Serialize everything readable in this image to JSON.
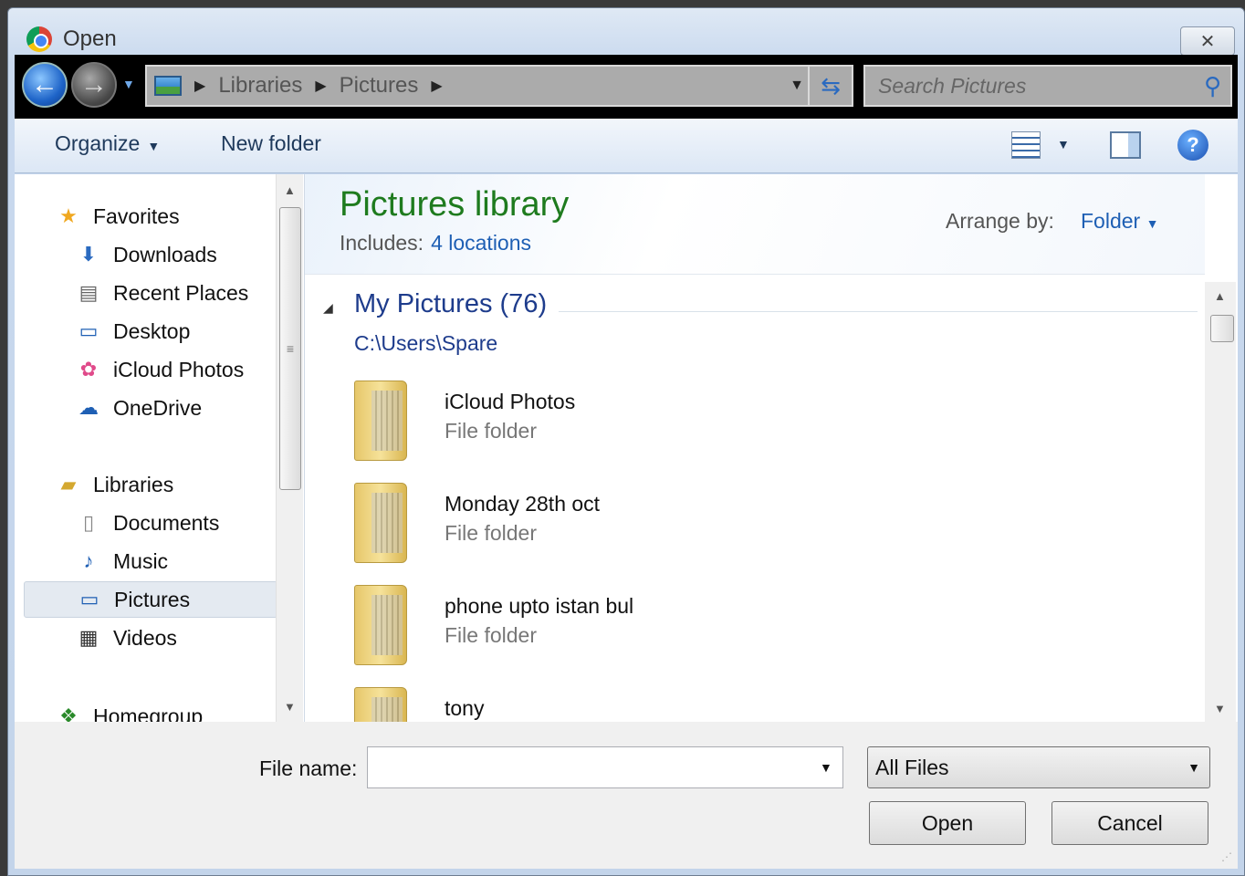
{
  "window": {
    "title": "Open",
    "close_icon": "close-icon"
  },
  "navigation": {
    "breadcrumbs": [
      "Libraries",
      "Pictures"
    ],
    "search_placeholder": "Search Pictures"
  },
  "toolbar": {
    "organize_label": "Organize",
    "new_folder_label": "New folder"
  },
  "sidebar": {
    "favorites": {
      "label": "Favorites",
      "items": [
        {
          "label": "Downloads",
          "icon": "downloads-icon"
        },
        {
          "label": "Recent Places",
          "icon": "recent-places-icon"
        },
        {
          "label": "Desktop",
          "icon": "desktop-icon"
        },
        {
          "label": "iCloud Photos",
          "icon": "icloud-photos-icon"
        },
        {
          "label": "OneDrive",
          "icon": "onedrive-icon"
        }
      ]
    },
    "libraries": {
      "label": "Libraries",
      "items": [
        {
          "label": "Documents",
          "icon": "documents-icon"
        },
        {
          "label": "Music",
          "icon": "music-icon"
        },
        {
          "label": "Pictures",
          "icon": "pictures-icon",
          "selected": true
        },
        {
          "label": "Videos",
          "icon": "videos-icon"
        }
      ]
    },
    "homegroup": {
      "label": "Homegroup"
    }
  },
  "library": {
    "title": "Pictures library",
    "includes_label": "Includes:",
    "locations_link": "4 locations",
    "arrange_label": "Arrange by:",
    "arrange_value": "Folder"
  },
  "group": {
    "title": "My Pictures (76)",
    "path": "C:\\Users\\Spare",
    "items": [
      {
        "name": "iCloud Photos",
        "type": "File folder"
      },
      {
        "name": "Monday 28th oct",
        "type": "File folder"
      },
      {
        "name": "phone upto istan bul",
        "type": "File folder"
      },
      {
        "name": "tony",
        "type": ""
      }
    ]
  },
  "footer": {
    "file_name_label": "File name:",
    "file_name_value": "",
    "filter_value": "All Files",
    "open_label": "Open",
    "cancel_label": "Cancel"
  },
  "colors": {
    "library_title": "#1e7b1e",
    "link": "#1e5fb4",
    "group_title": "#1e3c8c"
  }
}
